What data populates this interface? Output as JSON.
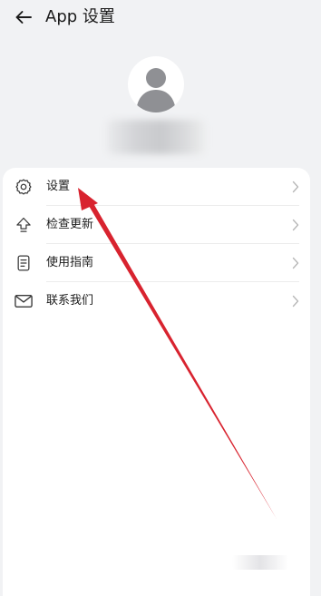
{
  "header": {
    "title": "App 设置",
    "back_icon": "arrow-left-icon"
  },
  "profile": {
    "avatar_icon": "default-user-avatar-icon"
  },
  "menu": {
    "items": [
      {
        "label": "设置",
        "icon": "gear-icon"
      },
      {
        "label": "检查更新",
        "icon": "upload-arrow-icon"
      },
      {
        "label": "使用指南",
        "icon": "document-icon"
      },
      {
        "label": "联系我们",
        "icon": "mail-icon"
      }
    ]
  },
  "annotation": {
    "color": "#d8232f"
  },
  "colors": {
    "background": "#f1f2f4",
    "card": "#ffffff",
    "text": "#1b1b1b",
    "icon": "#3a3a3a",
    "chevron": "#b8b8b8"
  }
}
